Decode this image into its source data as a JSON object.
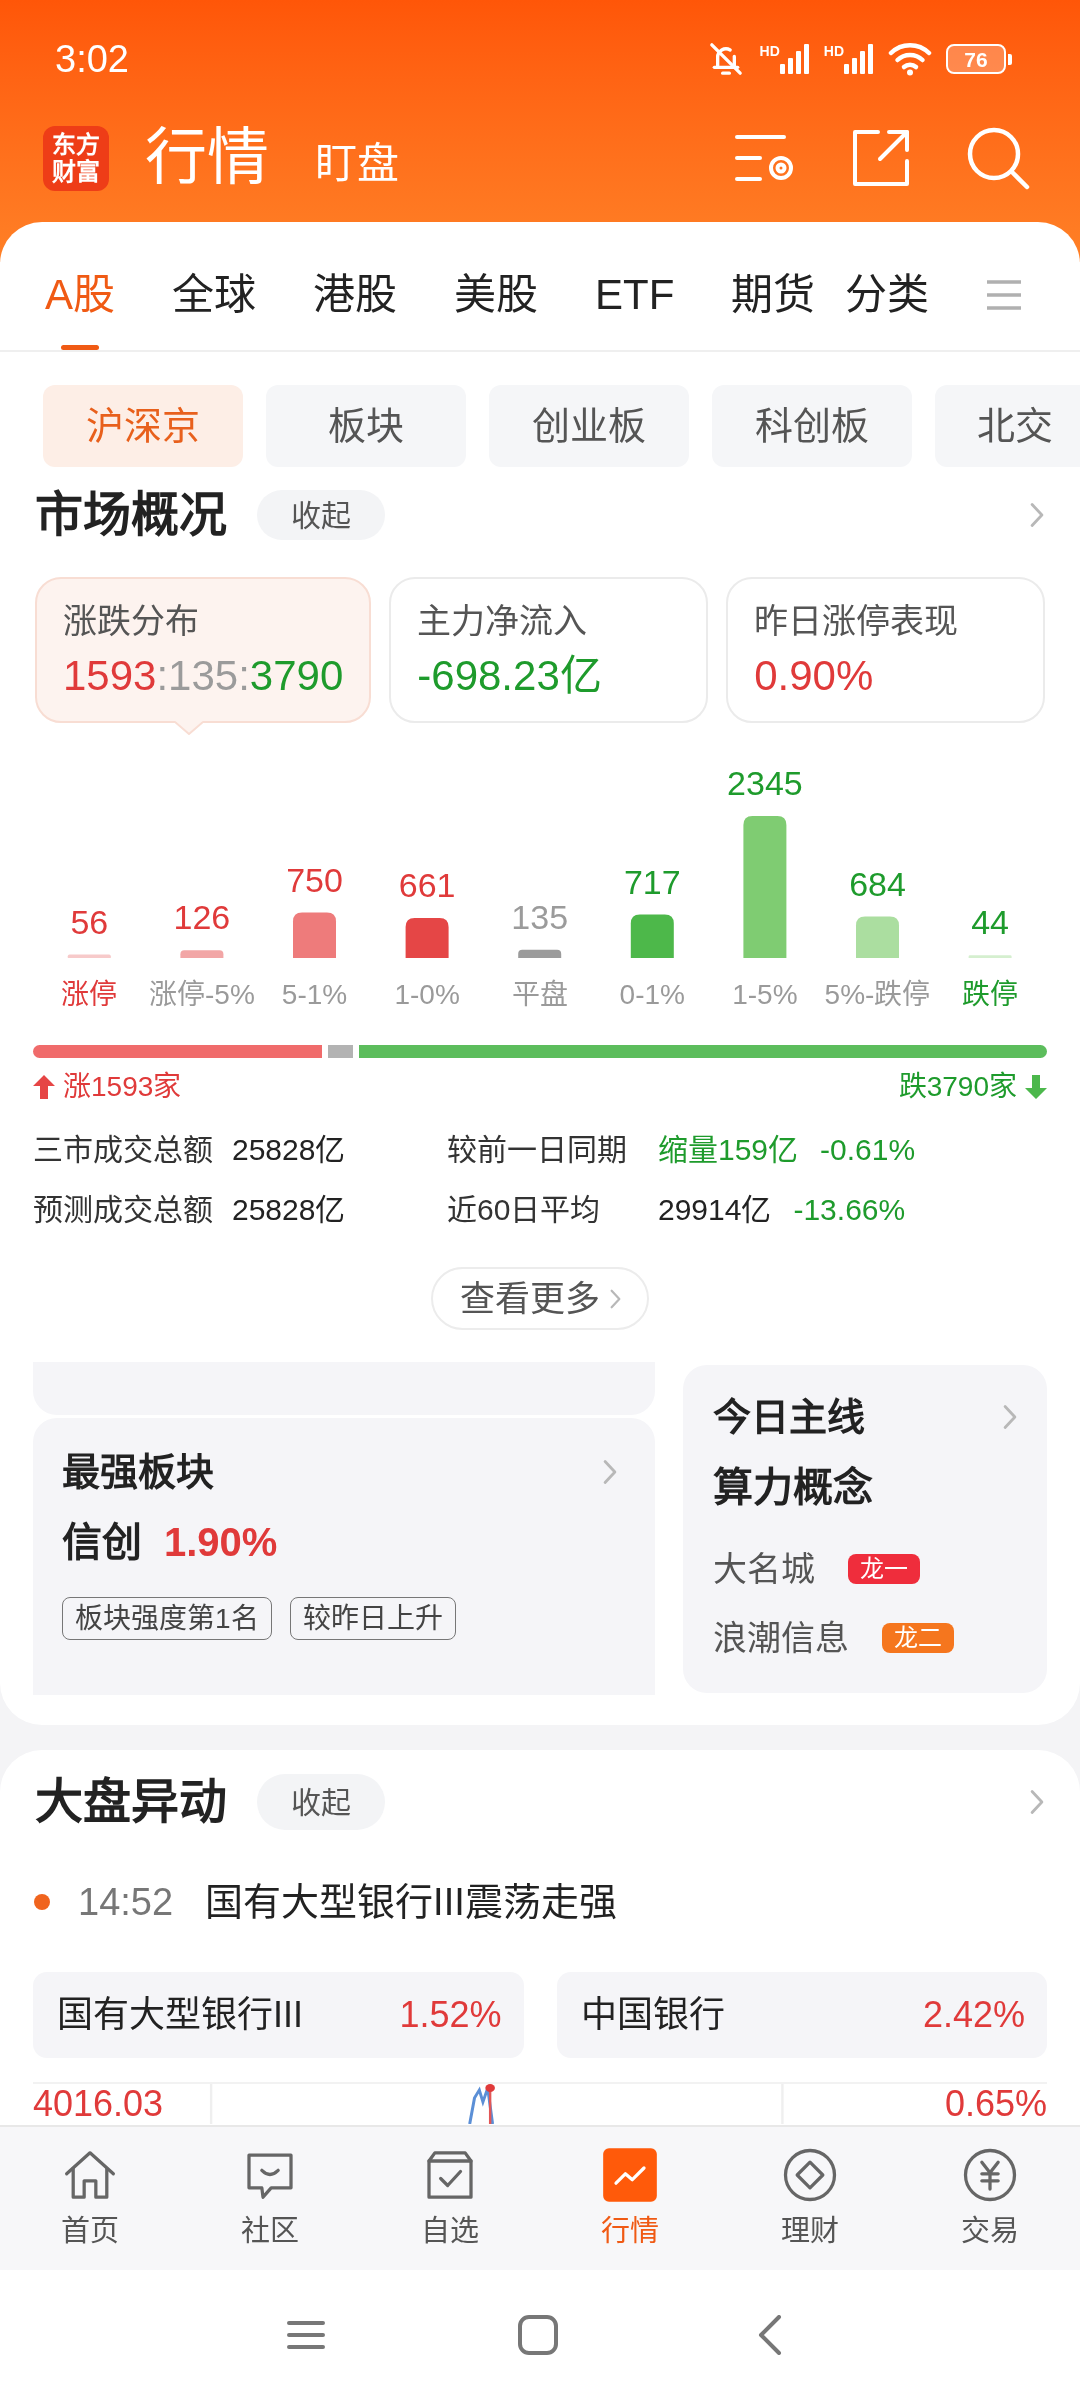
{
  "status_bar": {
    "time": "3:02",
    "network_types": [
      "HD",
      "HD"
    ],
    "battery": "76"
  },
  "header": {
    "logo": "东方财富",
    "title": "行情",
    "watch_link": "盯盘"
  },
  "market_tabs": [
    {
      "label": "A股",
      "selected": true
    },
    {
      "label": "全球",
      "selected": false
    },
    {
      "label": "港股",
      "selected": false
    },
    {
      "label": "美股",
      "selected": false
    },
    {
      "label": "ETF",
      "selected": false
    },
    {
      "label": "期货",
      "selected": false
    }
  ],
  "category_button": "分类",
  "board_tabs": [
    {
      "label": "沪深京",
      "selected": true
    },
    {
      "label": "板块",
      "selected": false
    },
    {
      "label": "创业板",
      "selected": false
    },
    {
      "label": "科创板",
      "selected": false
    },
    {
      "label": "北交",
      "selected": false
    }
  ],
  "market_overview": {
    "title": "市场概况",
    "collapse_button": "收起",
    "cards": [
      {
        "label": "涨跌分布",
        "selected": true,
        "value_parts": [
          {
            "text": "1593",
            "color": "#e03a3a"
          },
          {
            "text": ":135:",
            "color": "#9b9b9b"
          },
          {
            "text": "3790",
            "color": "#1e9b2c"
          }
        ]
      },
      {
        "label": "主力净流入",
        "selected": false,
        "value_parts": [
          {
            "text": "-698.23亿",
            "color": "#1e9b2c"
          }
        ]
      },
      {
        "label": "昨日涨停表现",
        "selected": false,
        "value_parts": [
          {
            "text": "0.90%",
            "color": "#e03a3a"
          }
        ]
      }
    ],
    "chart_data": {
      "type": "bar",
      "categories": [
        "涨停",
        "涨停-5%",
        "5-1%",
        "1-0%",
        "平盘",
        "0-1%",
        "1-5%",
        "5%-跌停",
        "跌停"
      ],
      "values": [
        56,
        126,
        750,
        661,
        135,
        717,
        2345,
        684,
        44
      ],
      "data_labels": true,
      "colors": [
        "#f7caca",
        "#f2a6a6",
        "#ee7b7b",
        "#e54646",
        "#9b9b9b",
        "#4db84a",
        "#7fcc72",
        "#abdea0",
        "#d5efcf"
      ]
    },
    "rise_count": "涨1593家",
    "fall_count": "跌3790家",
    "stats": [
      {
        "label": "三市成交总额",
        "value": "25828亿",
        "compare_label": "较前一日同期",
        "compare_values": [
          {
            "text": "缩量159亿",
            "color": "#1e9b2c"
          },
          {
            "text": "-0.61%",
            "color": "#1e9b2c"
          }
        ]
      },
      {
        "label": "预测成交总额",
        "value": "25828亿",
        "compare_label": "近60日平均",
        "compare_values": [
          {
            "text": "29914亿",
            "color": "#222222"
          },
          {
            "text": "-13.66%",
            "color": "#1e9b2c"
          }
        ]
      }
    ],
    "more_button": "查看更多"
  },
  "highlights": {
    "sector": {
      "title": "最强板块",
      "name": "信创",
      "change": "1.90%",
      "tags": [
        "板块强度第1名",
        "较昨日上升"
      ]
    },
    "theme": {
      "title": "今日主线",
      "name": "算力概念",
      "leaders": [
        {
          "name": "大名城",
          "badge": "龙一",
          "color": "#ef2d3c"
        },
        {
          "name": "浪潮信息",
          "badge": "龙二",
          "color": "#f5761e"
        }
      ]
    }
  },
  "market_moves": {
    "title": "大盘异动",
    "collapse_button": "收起",
    "events": [
      {
        "time": "14:52",
        "text": "国有大型银行III震荡走强"
      }
    ],
    "quotes": [
      {
        "name": "国有大型银行III",
        "change": "1.52%"
      },
      {
        "name": "中国银行",
        "change": "2.42%"
      }
    ],
    "mini_chart": {
      "price": "4016.03",
      "change": "0.65%"
    }
  },
  "bottom_nav": [
    {
      "label": "首页",
      "selected": false
    },
    {
      "label": "社区",
      "selected": false
    },
    {
      "label": "自选",
      "selected": false
    },
    {
      "label": "行情",
      "selected": true
    },
    {
      "label": "理财",
      "selected": false
    },
    {
      "label": "交易",
      "selected": false
    }
  ]
}
